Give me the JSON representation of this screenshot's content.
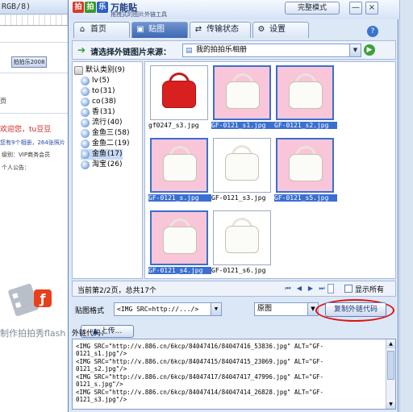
{
  "background_app": {
    "title_fragment": "RGB/8)",
    "tag_button": "拍拍乐2008",
    "section_label": "页",
    "welcome_text": "欢迎您，tu豆豆",
    "notice_text": "您有9个相册，264张照片",
    "level_text": "级别：VIP商务会员",
    "announcement_text": "个人公告：",
    "made_by_text": "制作拍拍秀flash"
  },
  "dialog": {
    "logo_chars": [
      "拍",
      "拍",
      "乐"
    ],
    "app_name": "万能贴",
    "app_subtitle": "拖拽式的图片外链工具",
    "mode_button": "完整模式",
    "minimize_glyph": "—",
    "close_glyph": "×"
  },
  "tabs": [
    {
      "label": "首页",
      "icon": "home-icon",
      "glyph": "⌂"
    },
    {
      "label": "贴图",
      "icon": "image-icon",
      "glyph": "▣"
    },
    {
      "label": "传输状态",
      "icon": "transfer-icon",
      "glyph": "⇄"
    },
    {
      "label": "设置",
      "icon": "settings-icon",
      "glyph": "⚙"
    }
  ],
  "help_glyph": "?",
  "source_bar": {
    "label": "请选择外链图片来源：",
    "selected": "我的拍拍乐相册",
    "go_glyph": "▶"
  },
  "tree": {
    "root": "默认类别(9)",
    "items": [
      {
        "name": "lv",
        "count": "(5)"
      },
      {
        "name": "to",
        "count": "(31)"
      },
      {
        "name": "co",
        "count": "(38)"
      },
      {
        "name": "香",
        "count": "(31)"
      },
      {
        "name": "流行",
        "count": "(40)"
      },
      {
        "name": "金鱼三",
        "count": "(58)"
      },
      {
        "name": "金鱼二",
        "count": "(19)"
      },
      {
        "name": "金鱼",
        "count": "(17)"
      },
      {
        "name": "淘宝",
        "count": "(26)"
      }
    ],
    "upload_label": "上传...",
    "upload_glyph": "▲"
  },
  "thumbnails": [
    {
      "name": "gf0247_s3.jpg",
      "selected": false,
      "red": true
    },
    {
      "name": "GF-0121_s1.jpg",
      "selected": true,
      "red": false
    },
    {
      "name": "GF-0121_s2.jpg",
      "selected": true,
      "red": false
    },
    {
      "name": "GF-0121_s.jpg",
      "selected": true,
      "red": false
    },
    {
      "name": "GF-0121_s3.jpg",
      "selected": false,
      "red": false
    },
    {
      "name": "GF-0121_s5.jpg",
      "selected": true,
      "red": false
    },
    {
      "name": "GF-0121_s4.jpg",
      "selected": true,
      "red": false
    },
    {
      "name": "GF-0121_s6.jpg",
      "selected": false,
      "red": false
    }
  ],
  "pager": {
    "info": "当前第2/2页，总共17个",
    "nav_glyphs": [
      "⏮",
      "◀",
      "▶",
      "⏭"
    ],
    "show_all_label": "显示所有"
  },
  "format_bar": {
    "label": "贴图格式",
    "format_value": "<IMG SRC=http://.../>",
    "size_value": "原图",
    "copy_button": "复制外链代码",
    "dropdown_glyph": "▼"
  },
  "output": {
    "label": "外链代码：",
    "lines": [
      "<IMG SRC=\"http://v.886.cn/6kcp/84047416/84047416_53836.jpg\" ALT=\"GF-",
      "0121_s1.jpg\"/>",
      "<IMG SRC=\"http://v.886.cn/6kcp/84047415/84047415_23069.jpg\" ALT=\"GF-",
      "0121_s2.jpg\"/>",
      "<IMG SRC=\"http://v.886.cn/6kcp/84047417/84047417_47996.jpg\" ALT=\"GF-",
      "0121_s.jpg\"/>",
      "<IMG SRC=\"http://v.886.cn/6kcp/84047414/84047414_26828.jpg\" ALT=\"GF-",
      "0121_s3.jpg\"/>"
    ]
  },
  "colors": {
    "accent_blue": "#3b6fd0",
    "highlight_red": "#e01010",
    "dialog_bg": "#dde8f6"
  }
}
